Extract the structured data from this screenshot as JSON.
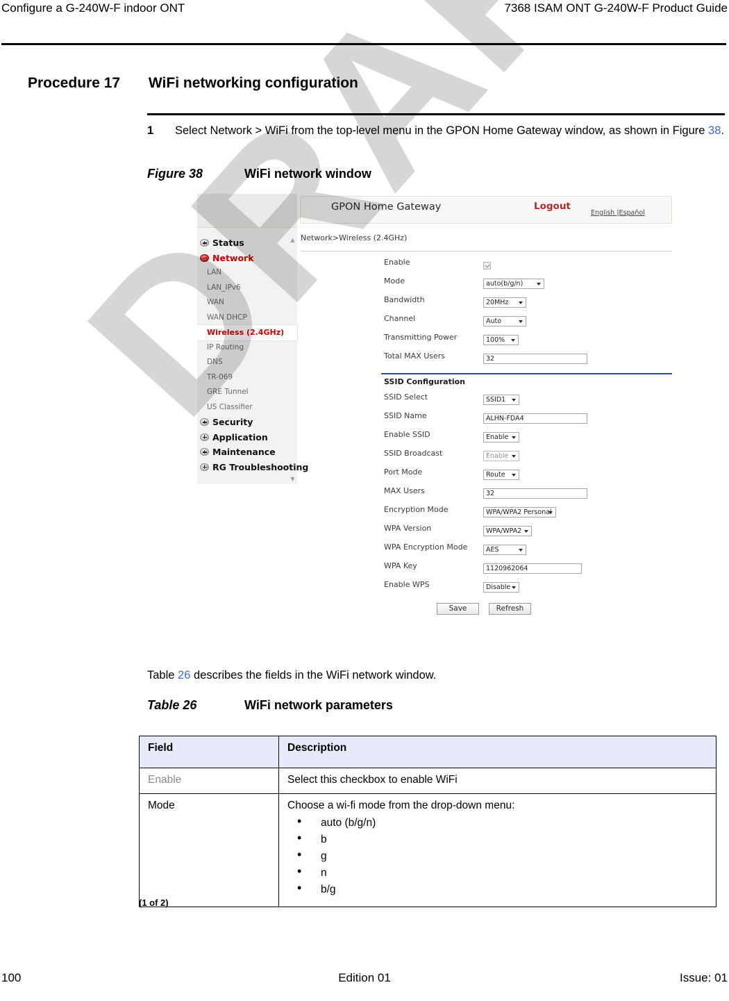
{
  "page": {
    "running_head_left": "Configure a G-240W-F indoor ONT",
    "running_head_right": "7368 ISAM ONT G-240W-F Product Guide",
    "watermark": "DRAFT",
    "footer_left": "100",
    "footer_center": "Edition 01",
    "footer_right": "Issue: 01"
  },
  "procedure": {
    "number": "Procedure 17",
    "title": "WiFi networking configuration",
    "step_number": "1",
    "step_text_before": "Select Network > WiFi from the top-level menu in the GPON Home Gateway window, as shown in Figure ",
    "step_xref": "38",
    "step_text_after": "."
  },
  "figure": {
    "label": "Figure 38",
    "title": "WiFi network window"
  },
  "screenshot": {
    "app_title": "GPON Home Gateway",
    "logout_label": "Logout",
    "lang_english": "English",
    "lang_separator": " |",
    "lang_spanish": "Español",
    "breadcrumb": "Network>Wireless (2.4GHz)",
    "scroll_up_glyph": "▲",
    "scroll_down_glyph": "▼",
    "nav": [
      {
        "label": "Status",
        "type": "group",
        "state": "collapsed"
      },
      {
        "label": "Network",
        "type": "group",
        "state": "expanded"
      },
      {
        "label": "LAN",
        "type": "child",
        "state": "normal"
      },
      {
        "label": "LAN_IPv6",
        "type": "child",
        "state": "normal"
      },
      {
        "label": "WAN",
        "type": "child",
        "state": "normal"
      },
      {
        "label": "WAN DHCP",
        "type": "child",
        "state": "normal"
      },
      {
        "label": "Wireless (2.4GHz)",
        "type": "child",
        "state": "active"
      },
      {
        "label": "IP Routing",
        "type": "child",
        "state": "normal"
      },
      {
        "label": "DNS",
        "type": "child",
        "state": "normal"
      },
      {
        "label": "TR-069",
        "type": "child",
        "state": "normal"
      },
      {
        "label": "GRE Tunnel",
        "type": "child",
        "state": "normal"
      },
      {
        "label": "US Classifier",
        "type": "child",
        "state": "normal"
      },
      {
        "label": "Security",
        "type": "group",
        "state": "collapsed"
      },
      {
        "label": "Application",
        "type": "group",
        "state": "collapsed"
      },
      {
        "label": "Maintenance",
        "type": "group",
        "state": "collapsed"
      },
      {
        "label": "RG Troubleshooting",
        "type": "group",
        "state": "collapsed"
      }
    ],
    "general": {
      "enable_label": "Enable",
      "enable_checked": true,
      "mode_label": "Mode",
      "mode_value": "auto(b/g/n)",
      "bandwidth_label": "Bandwidth",
      "bandwidth_value": "20MHz",
      "channel_label": "Channel",
      "channel_value": "Auto",
      "power_label": "Transmitting Power",
      "power_value": "100%",
      "total_max_users_label": "Total MAX Users",
      "total_max_users_value": "32"
    },
    "ssid_section_title": "SSID Configuration",
    "ssid": {
      "ssid_select_label": "SSID Select",
      "ssid_select_value": "SSID1",
      "ssid_name_label": "SSID Name",
      "ssid_name_value": "ALHN-FDA4",
      "enable_ssid_label": "Enable SSID",
      "enable_ssid_value": "Enable",
      "ssid_broadcast_label": "SSID Broadcast",
      "ssid_broadcast_value": "Enable",
      "port_mode_label": "Port Mode",
      "port_mode_value": "Route",
      "max_users_label": "MAX Users",
      "max_users_value": "32",
      "encryption_mode_label": "Encryption Mode",
      "encryption_mode_value": "WPA/WPA2 Personal",
      "wpa_version_label": "WPA Version",
      "wpa_version_value": "WPA/WPA2",
      "wpa_encryption_mode_label": "WPA Encryption Mode",
      "wpa_encryption_mode_value": "AES",
      "wpa_key_label": "WPA Key",
      "wpa_key_value": "1120962064",
      "enable_wps_label": "Enable WPS",
      "enable_wps_value": "Disable"
    },
    "buttons": {
      "save": "Save",
      "refresh": "Refresh"
    }
  },
  "table": {
    "lead_before": "Table ",
    "lead_xref": "26",
    "lead_after": " describes the fields in the WiFi network window.",
    "caption_label": "Table 26",
    "caption_title": "WiFi network parameters",
    "headers": [
      "Field",
      "Description"
    ],
    "rows": [
      {
        "field": "Enable",
        "field_faded": true,
        "description": "Select this checkbox to enable WiFi",
        "bullets": []
      },
      {
        "field": "Mode",
        "field_faded": false,
        "description": "Choose a wi-fi mode from the drop-down menu:",
        "bullets": [
          "auto (b/g/n)",
          "b",
          "g",
          "n",
          "b/g"
        ]
      }
    ],
    "continuation": "(1 of 2)"
  }
}
